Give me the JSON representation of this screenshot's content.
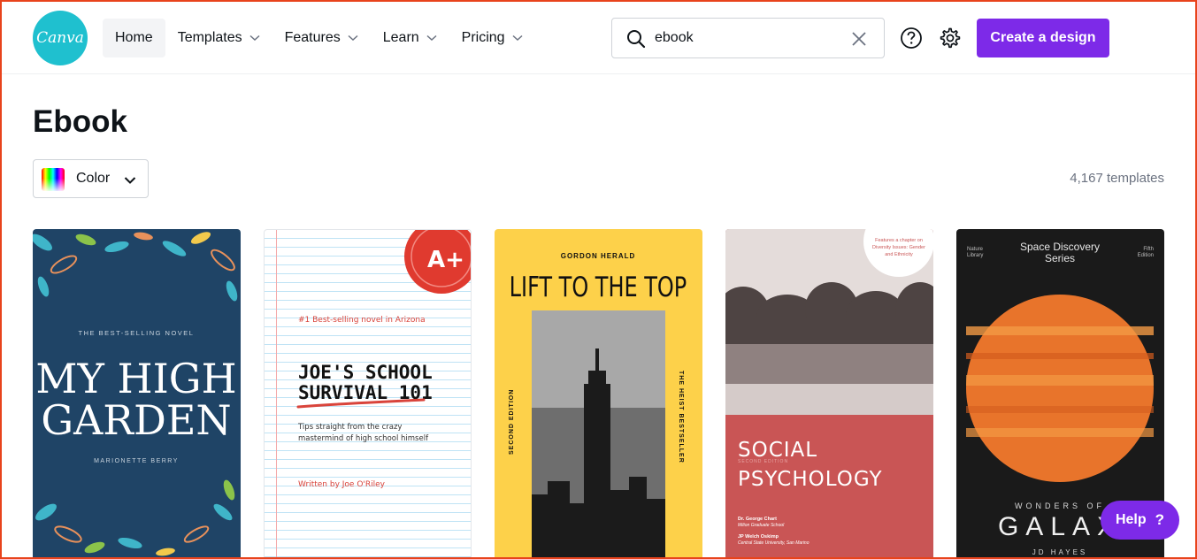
{
  "header": {
    "logo_text": "Canva",
    "nav": [
      {
        "label": "Home"
      },
      {
        "label": "Templates"
      },
      {
        "label": "Features"
      },
      {
        "label": "Learn"
      },
      {
        "label": "Pricing"
      }
    ],
    "search": {
      "value": "ebook",
      "placeholder": ""
    },
    "create_label": "Create a design"
  },
  "page": {
    "title": "Ebook",
    "filter_color_label": "Color",
    "template_count": "4,167 templates"
  },
  "cards": [
    {
      "overline": "THE BEST-SELLING NOVEL",
      "title_line1": "MY HIGH",
      "title_line2": "GARDEN",
      "author": "MARIONETTE BERRY"
    },
    {
      "badge": "A+",
      "tag": "#1 Best-selling novel in Arizona",
      "title_line1": "JOE'S SCHOOL",
      "title_line2": "SURVIVAL 101",
      "subtitle_line1": "Tips straight from the crazy",
      "subtitle_line2": "mastermind of high school himself",
      "byline": "Written by Joe O'Riley"
    },
    {
      "author": "GORDON HERALD",
      "title": "LIFT TO THE TOP",
      "left_vertical": "SECOND EDITION",
      "right_vertical": "THE HEIST BESTSELLER"
    },
    {
      "badge_line1": "Features a chapter on",
      "badge_line2": "Diversity Issues: Gender",
      "badge_line3": "and Ethnicity",
      "title_line1": "SOCIAL",
      "edition": "SECOND EDITION",
      "title_line2": "PSYCHOLOGY",
      "author1": "Dr. George Chart",
      "school1": "Milton Graduate School",
      "author2": "JP Welch Oskimp",
      "school2": "Central State University, San Marino"
    },
    {
      "corner_left_line1": "Nature",
      "corner_left_line2": "Library",
      "series_line1": "Space Discovery",
      "series_line2": "Series",
      "corner_right_line1": "Fifth",
      "corner_right_line2": "Edition",
      "overline": "WONDERS OF",
      "title": "GALAX",
      "author": "JD HAYES"
    }
  ],
  "help": {
    "label": "Help",
    "icon_label": "?"
  },
  "colors": {
    "brand_purple": "#7d2ae8",
    "logo_teal": "#1fc0cf",
    "frame": "#e8431c"
  }
}
